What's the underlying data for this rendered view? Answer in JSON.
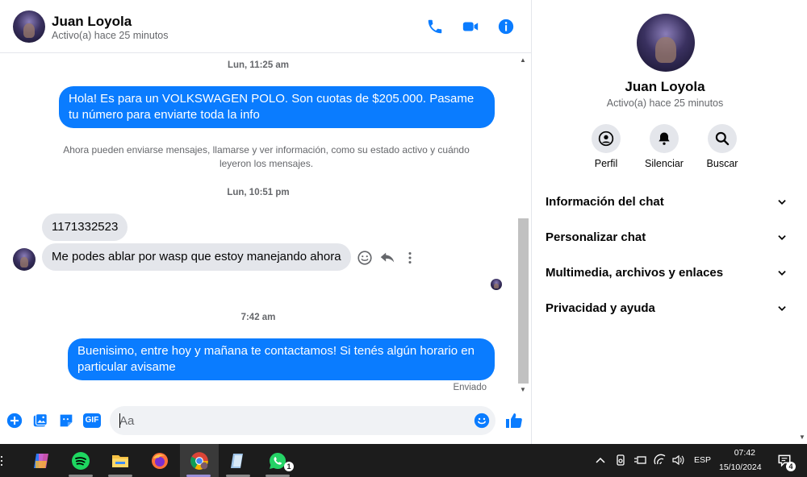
{
  "contact": {
    "name": "Juan Loyola",
    "status": "Activo(a) hace 25 minutos"
  },
  "messages": {
    "ts1": "Lun, 11:25 am",
    "out1": "Hola! Es para un VOLKSWAGEN POLO. Son cuotas de $205.000. Pasame tu número para enviarte toda la info",
    "note": "Ahora pueden enviarse mensajes, llamarse y ver información, como su estado activo y cuándo leyeron los mensajes.",
    "ts2": "Lun, 10:51 pm",
    "in1": "1171332523",
    "in2": "Me podes ablar por wasp que estoy manejando ahora",
    "ts3": "7:42 am",
    "out2": "Buenisimo, entre hoy y mañana te contactamos! Si tenés algún horario en particular avisame",
    "sent": "Enviado"
  },
  "composer": {
    "placeholder": "Aa",
    "gif_label": "GIF"
  },
  "side": {
    "actions": [
      {
        "label": "Perfil",
        "icon": "profile-icon"
      },
      {
        "label": "Silenciar",
        "icon": "bell-icon"
      },
      {
        "label": "Buscar",
        "icon": "search-icon"
      }
    ],
    "sections": [
      "Información del chat",
      "Personalizar chat",
      "Multimedia, archivos y enlaces",
      "Privacidad y ayuda"
    ]
  },
  "taskbar": {
    "lang": "ESP",
    "time": "07:42",
    "date": "15/10/2024",
    "whatsapp_badge": "1",
    "notif_badge": "4"
  },
  "colors": {
    "accent": "#0a7cff",
    "bubble_in": "#e4e6eb"
  }
}
